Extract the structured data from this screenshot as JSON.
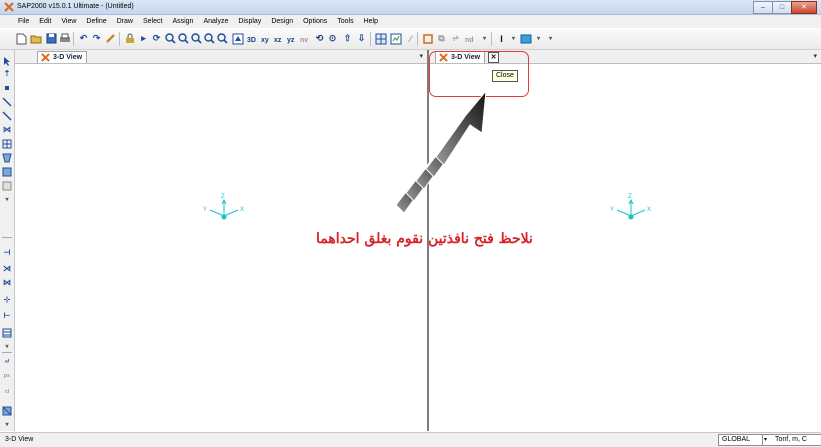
{
  "window": {
    "title": "SAP2000 v15.0.1 Ultimate  - (Untitled)",
    "min": "–",
    "max": "□",
    "close": "✕"
  },
  "menu": [
    "File",
    "Edit",
    "View",
    "Define",
    "Draw",
    "Select",
    "Assign",
    "Analyze",
    "Display",
    "Design",
    "Options",
    "Tools",
    "Help"
  ],
  "toolbar": {
    "xy": "xy",
    "xz": "xz",
    "yz": "yz",
    "nv": "nv",
    "nd": "nd"
  },
  "tabs": {
    "left": "3-D View",
    "right": "3-D View",
    "close_glyph": "✕",
    "dropdown": "▾"
  },
  "tooltip": {
    "text": "Close"
  },
  "annotation": {
    "text": "نلاحظ فتح نافذتين نقوم بغلق احداهما"
  },
  "axes": {
    "z": "Z",
    "x": "X",
    "y": "Y"
  },
  "status": {
    "left": "3-D View",
    "coord_system": "GLOBAL",
    "units": "Tonf, m, C",
    "dropdown": "▾"
  },
  "colors": {
    "accent_red": "#e23b3b",
    "annotation_red": "#d8232a",
    "axis_cyan": "#19c3c3"
  },
  "icons": [
    "app-logo-icon",
    "new-file-icon",
    "open-icon",
    "save-icon",
    "print-icon",
    "undo-icon",
    "redo-icon",
    "pencil-icon",
    "lock-icon",
    "run-icon",
    "refresh-icon",
    "zoom-in-icon",
    "zoom-out-icon",
    "pan-icon",
    "3d-view-icon",
    "up-arrow-icon",
    "down-arrow-icon",
    "pointer-icon",
    "joint-icon",
    "frame-icon",
    "area-icon",
    "close-icon"
  ]
}
